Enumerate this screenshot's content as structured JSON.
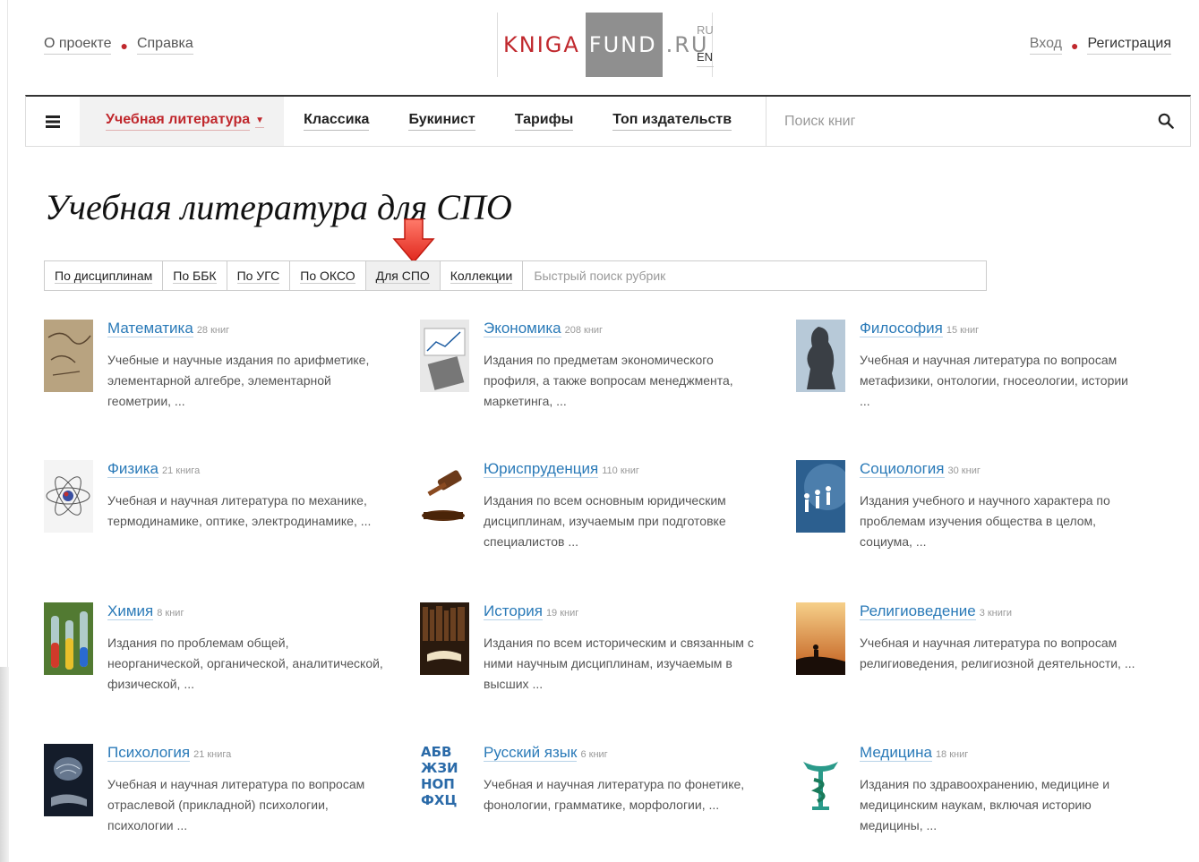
{
  "header": {
    "about": "О проекте",
    "help": "Справка",
    "logo": {
      "part1": "KNIGA",
      "part2": "FUND",
      "part3": ".RU"
    },
    "lang": {
      "ru": "RU",
      "en": "EN"
    },
    "login": "Вход",
    "register": "Регистрация"
  },
  "nav": {
    "items": [
      "Учебная литература",
      "Классика",
      "Букинист",
      "Тарифы",
      "Топ издательств"
    ],
    "search_placeholder": "Поиск книг"
  },
  "page": {
    "title": "Учебная литература для СПО",
    "tabs": [
      "По дисциплинам",
      "По ББК",
      "По УГС",
      "По ОКСО",
      "Для СПО",
      "Коллекции"
    ],
    "active_tab": "Для СПО",
    "tab_search_placeholder": "Быстрый поиск рубрик"
  },
  "colors": {
    "accent": "#c0282d",
    "link": "#2a7ab8",
    "logo_gray": "#8f8f8f"
  },
  "categories": [
    {
      "title": "Математика",
      "count": "28 книг",
      "desc": "Учебные и научные издания по арифметике, элементарной алгебре, элементарной геометрии, ..."
    },
    {
      "title": "Экономика",
      "count": "208 книг",
      "desc": "Издания по предметам экономического профиля, а также вопросам менеджмента, маркетинга, ..."
    },
    {
      "title": "Философия",
      "count": "15 книг",
      "desc": "Учебная и научная литература по вопросам метафизики, онтологии, гносеологии, истории ..."
    },
    {
      "title": "Физика",
      "count": "21 книга",
      "desc": "Учебная и научная литература по механике, термодинамике, оптике, электродинамике, ..."
    },
    {
      "title": "Юриспруденция",
      "count": "110 книг",
      "desc": "Издания по всем основным юридическим дисциплинам, изучаемым при подготовке специалистов ..."
    },
    {
      "title": "Социология",
      "count": "30 книг",
      "desc": "Издания учебного и научного характера по проблемам изучения общества в целом, социума, ..."
    },
    {
      "title": "Химия",
      "count": "8 книг",
      "desc": "Издания по проблемам общей, неорганической, органической, аналитической, физической, ..."
    },
    {
      "title": "История",
      "count": "19 книг",
      "desc": "Издания по всем историческим и связанным с ними научным дисциплинам, изучаемым в высших ..."
    },
    {
      "title": "Религиоведение",
      "count": "3 книги",
      "desc": "Учебная и научная литература по вопросам религиоведения, религиозной деятельности, ..."
    },
    {
      "title": "Психология",
      "count": "21 книга",
      "desc": "Учебная и научная литература по вопросам отраслевой (прикладной) психологии, психологии ..."
    },
    {
      "title": "Русский язык",
      "count": "6 книг",
      "desc": "Учебная и научная литература по фонетике, фонологии, грамматике, морфологии, ..."
    },
    {
      "title": "Медицина",
      "count": "18 книг",
      "desc": "Издания по здравоохранению, медицине и медицинским наукам, включая историю медицины, ..."
    }
  ]
}
